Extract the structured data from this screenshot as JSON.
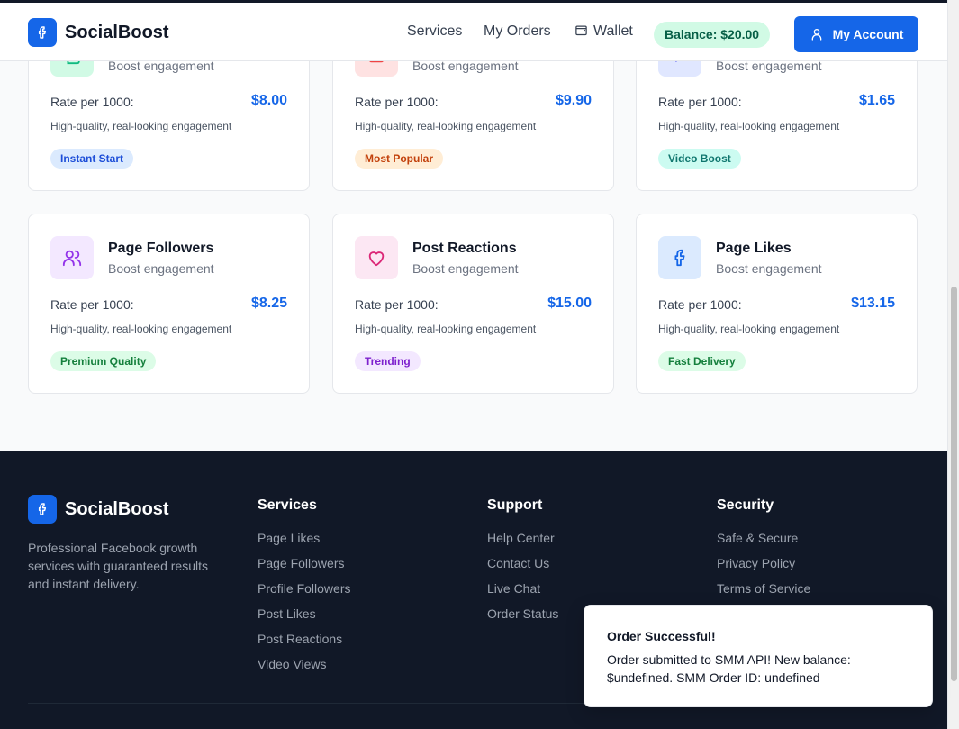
{
  "header": {
    "brand": "SocialBoost",
    "nav": [
      "Services",
      "My Orders",
      "Wallet"
    ],
    "balance": "Balance: $20.00",
    "account": "My Account"
  },
  "cards_top": [
    {
      "subtitle": "Boost engagement",
      "rate_label": "Rate per 1000:",
      "price": "$8.00",
      "desc": "High-quality, real-looking engagement",
      "badge": "Instant Start",
      "icon": "thumbs-up-icon",
      "icon_bg": "#d1fae5",
      "icon_color": "#10b981",
      "badge_bg": "#dbeafe",
      "badge_fg": "#1d4ed8"
    },
    {
      "subtitle": "Boost engagement",
      "rate_label": "Rate per 1000:",
      "price": "$9.90",
      "desc": "High-quality, real-looking engagement",
      "badge": "Most Popular",
      "icon": "user-icon",
      "icon_bg": "#fee2e2",
      "icon_color": "#ef4444",
      "badge_bg": "#ffedd5",
      "badge_fg": "#c2410c"
    },
    {
      "subtitle": "Boost engagement",
      "rate_label": "Rate per 1000:",
      "price": "$1.65",
      "desc": "High-quality, real-looking engagement",
      "badge": "Video Boost",
      "icon": "play-icon",
      "icon_bg": "#e0e7ff",
      "icon_color": "#6366f1",
      "badge_bg": "#ccfbf1",
      "badge_fg": "#0f766e"
    }
  ],
  "cards_bottom": [
    {
      "title": "Page Followers",
      "subtitle": "Boost engagement",
      "rate_label": "Rate per 1000:",
      "price": "$8.25",
      "desc": "High-quality, real-looking engagement",
      "badge": "Premium Quality",
      "icon": "users-icon",
      "icon_bg": "#f3e8ff",
      "icon_color": "#9333ea",
      "badge_bg": "#dcfce7",
      "badge_fg": "#15803d"
    },
    {
      "title": "Post Reactions",
      "subtitle": "Boost engagement",
      "rate_label": "Rate per 1000:",
      "price": "$15.00",
      "desc": "High-quality, real-looking engagement",
      "badge": "Trending",
      "icon": "heart-icon",
      "icon_bg": "#fce7f3",
      "icon_color": "#db2777",
      "badge_bg": "#f3e8ff",
      "badge_fg": "#7e22ce"
    },
    {
      "title": "Page Likes",
      "subtitle": "Boost engagement",
      "rate_label": "Rate per 1000:",
      "price": "$13.15",
      "desc": "High-quality, real-looking engagement",
      "badge": "Fast Delivery",
      "icon": "facebook-icon",
      "icon_bg": "#dbeafe",
      "icon_color": "#1566e8",
      "badge_bg": "#dcfce7",
      "badge_fg": "#15803d"
    }
  ],
  "footer": {
    "brand": "SocialBoost",
    "description": "Professional Facebook growth services with guaranteed results and instant delivery.",
    "services": {
      "heading": "Services",
      "links": [
        "Page Likes",
        "Page Followers",
        "Profile Followers",
        "Post Likes",
        "Post Reactions",
        "Video Views"
      ]
    },
    "support": {
      "heading": "Support",
      "links": [
        "Help Center",
        "Contact Us",
        "Live Chat",
        "Order Status"
      ]
    },
    "security": {
      "heading": "Security",
      "links": [
        "Safe & Secure",
        "Privacy Policy",
        "Terms of Service"
      ]
    }
  },
  "toast": {
    "title": "Order Successful!",
    "message": "Order submitted to SMM API! New balance: $undefined. SMM Order ID: undefined"
  },
  "colors": {
    "accent": "#1566e8",
    "footer_bg": "#111827"
  }
}
